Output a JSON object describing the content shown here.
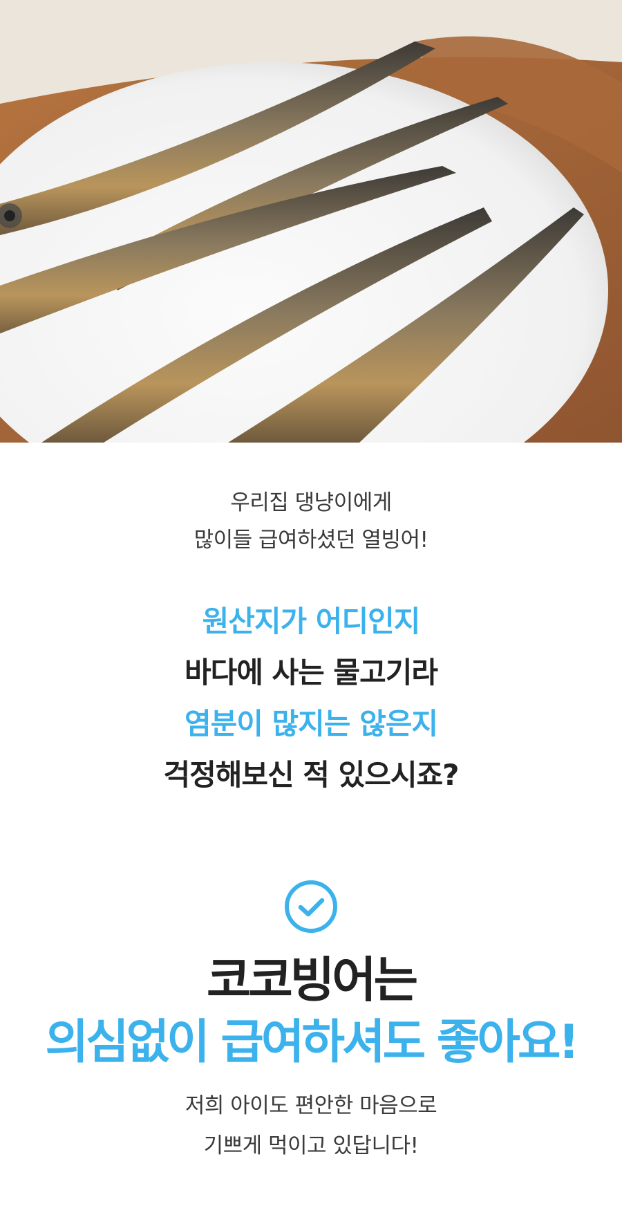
{
  "hero": {
    "image_name": "dried-smelt-on-plate"
  },
  "intro": {
    "line1": "우리집 댕냥이에게",
    "line2": "많이들 급여하셨던 열빙어!"
  },
  "questions": [
    {
      "text": "원산지가 어디인지",
      "accent": true
    },
    {
      "text": "바다에 사는 물고기라",
      "accent": false
    },
    {
      "text": "염분이 많지는 않은지",
      "accent": true
    },
    {
      "text": "걱정해보신 적 있으시죠?",
      "accent": false
    }
  ],
  "check_icon": "check-circle-icon",
  "headline": {
    "line1": "코코빙어는",
    "line2": "의심없이 급여하셔도 좋아요!"
  },
  "outro": {
    "line1": "저희 아이도 편안한 마음으로",
    "line2": "기쁘게 먹이고 있답니다!"
  },
  "colors": {
    "accent": "#3cb2ec",
    "dark": "#222222",
    "body": "#3a3a3a"
  }
}
